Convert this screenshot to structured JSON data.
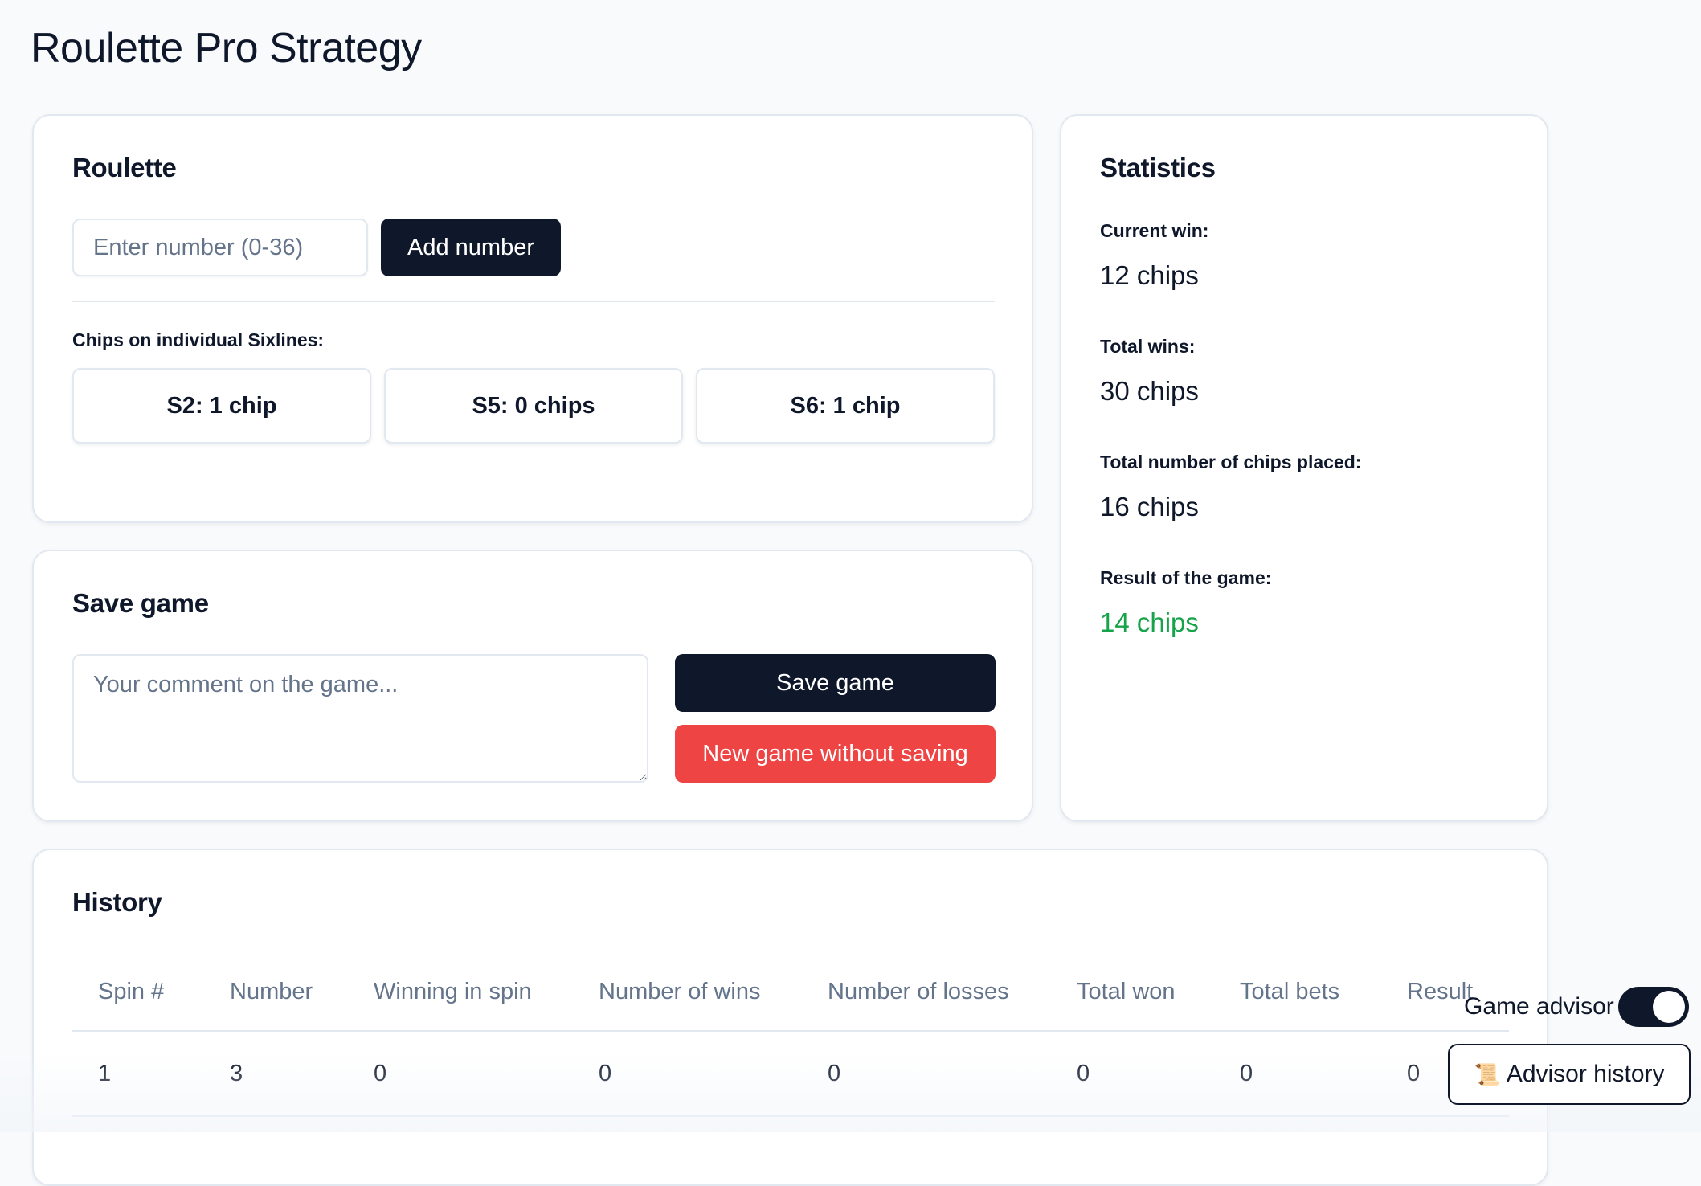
{
  "app": {
    "title": "Roulette Pro Strategy"
  },
  "roulette": {
    "title": "Roulette",
    "input_placeholder": "Enter number (0-36)",
    "add_button": "Add number",
    "chips_label": "Chips on individual Sixlines:",
    "sixlines": [
      {
        "label": "S2: 1 chip"
      },
      {
        "label": "S5: 0 chips"
      },
      {
        "label": "S6: 1 chip"
      }
    ]
  },
  "save_game": {
    "title": "Save game",
    "comment_placeholder": "Your comment on the game...",
    "save_button": "Save game",
    "new_game_button": "New game without saving"
  },
  "statistics": {
    "title": "Statistics",
    "items": [
      {
        "label": "Current win:",
        "value": "12 chips"
      },
      {
        "label": "Total wins:",
        "value": "30 chips"
      },
      {
        "label": "Total number of chips placed:",
        "value": "16 chips"
      },
      {
        "label": "Result of the game:",
        "value": "14 chips"
      }
    ],
    "result_color": "#16a34a"
  },
  "history": {
    "title": "History",
    "columns": [
      "Spin #",
      "Number",
      "Winning in spin",
      "Number of wins",
      "Number of losses",
      "Total won",
      "Total bets",
      "Result"
    ],
    "rows": [
      [
        "1",
        "3",
        "0",
        "0",
        "0",
        "0",
        "0",
        "0"
      ]
    ]
  },
  "advisor": {
    "label": "Game advisor",
    "enabled": true,
    "history_button": "Advisor history",
    "history_icon": "scroll-icon"
  },
  "colors": {
    "primary": "#0f172a",
    "danger": "#ef4444",
    "success": "#16a34a",
    "muted": "#64748b",
    "border": "#e2e8f0"
  }
}
